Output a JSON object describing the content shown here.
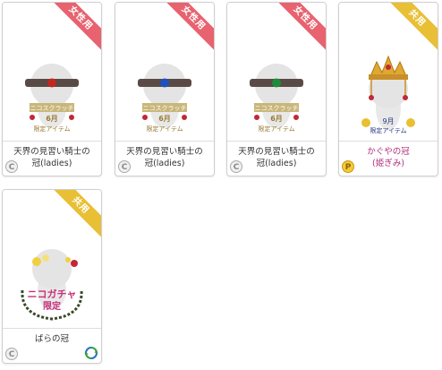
{
  "items": [
    {
      "name": "天界の見習い騎士の\n冠(ladies)",
      "ribbon": "女性用",
      "ribbon_type": "ladies",
      "currency": "C",
      "thumb": {
        "line1": "ニコスクラッチ",
        "line2": "6月",
        "line3": "限定アイテム",
        "gem_color": "#c0281e"
      }
    },
    {
      "name": "天界の見習い騎士の\n冠(ladies)",
      "ribbon": "女性用",
      "ribbon_type": "ladies",
      "currency": "C",
      "thumb": {
        "line1": "ニコスクラッチ",
        "line2": "6月",
        "line3": "限定アイテム",
        "gem_color": "#1e50c0"
      }
    },
    {
      "name": "天界の見習い騎士の\n冠(ladies)",
      "ribbon": "女性用",
      "ribbon_type": "ladies",
      "currency": "C",
      "thumb": {
        "line1": "ニコスクラッチ",
        "line2": "6月",
        "line3": "限定アイテム",
        "gem_color": "#1e8c3c"
      }
    },
    {
      "name": "かぐやの冠\n(姫ぎみ)",
      "ribbon": "共用",
      "ribbon_type": "shared",
      "currency": "P",
      "thumb": {
        "line1": "9月",
        "line2": "限定アイテム"
      }
    },
    {
      "name": "ばらの冠",
      "ribbon": "共用",
      "ribbon_type": "shared",
      "currency": "C",
      "thumb": {
        "line1": "ニコガチャ",
        "line2": "限定"
      },
      "recycle_icon": "recycle-icon"
    }
  ],
  "colors": {
    "ladies": "#e8626f",
    "shared": "#e8bf35",
    "name_pink": "#b0307a"
  }
}
